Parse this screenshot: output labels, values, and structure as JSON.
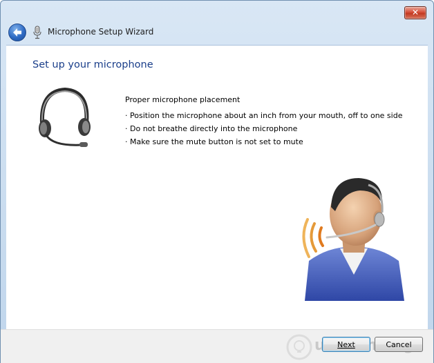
{
  "window": {
    "close_label": "✕"
  },
  "nav": {
    "title": "Microphone Setup Wizard"
  },
  "main": {
    "page_title": "Set up your microphone",
    "placement_heading": "Proper microphone placement",
    "bullets": [
      "· Position the microphone about an inch from your mouth, off to one side",
      "· Do not breathe directly into the microphone",
      "· Make sure the mute button is not set to mute"
    ]
  },
  "footer": {
    "next_label": "Next",
    "cancel_label": "Cancel",
    "watermark_text": "uantrimang"
  },
  "icons": {
    "back": "back-arrow-icon",
    "microphone": "microphone-icon",
    "headset": "headset-icon",
    "person": "person-with-headset-icon",
    "watermark_logo": "lightbulb-logo"
  },
  "colors": {
    "title_blue": "#1a3e8a",
    "chrome_blue": "#c9dcef",
    "close_red": "#c23a22"
  }
}
